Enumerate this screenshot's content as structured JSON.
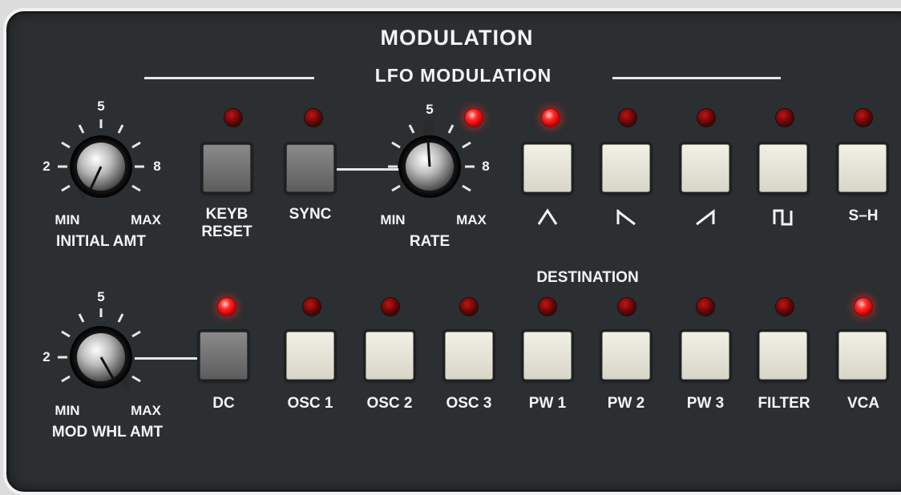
{
  "panel": {
    "title": "MODULATION",
    "subtitle": "LFO MODULATION",
    "destination_label": "DESTINATION"
  },
  "knobs": {
    "initial_amt": {
      "label": "INITIAL AMT",
      "scale_min_label": "MIN",
      "scale_max_label": "MAX",
      "tick_2": "2",
      "tick_5": "5",
      "tick_8": "8"
    },
    "rate": {
      "label": "RATE",
      "scale_min_label": "MIN",
      "scale_max_label": "MAX",
      "tick_5": "5",
      "tick_8": "8"
    },
    "mod_whl_amt": {
      "label": "MOD WHL AMT",
      "scale_min_label": "MIN",
      "scale_max_label": "MAX",
      "tick_2": "2",
      "tick_5": "5"
    }
  },
  "top_row": {
    "keyb_reset": {
      "label_line1": "KEYB",
      "label_line2": "RESET",
      "led_on": false
    },
    "sync": {
      "label": "SYNC",
      "led_on": false
    },
    "rate_led_on": true,
    "waveforms": [
      {
        "name": "triangle",
        "icon": "triangle-wave-icon",
        "led_on": true
      },
      {
        "name": "ramp-down",
        "icon": "ramp-down-wave-icon",
        "led_on": false
      },
      {
        "name": "sawtooth",
        "icon": "sawtooth-wave-icon",
        "led_on": false
      },
      {
        "name": "square",
        "icon": "square-wave-icon",
        "led_on": false
      },
      {
        "name": "sample-hold",
        "label": "S–H",
        "led_on": false
      }
    ]
  },
  "bottom_row": {
    "dc": {
      "label": "DC",
      "led_on": true
    },
    "destinations": [
      {
        "label": "OSC 1",
        "led_on": false
      },
      {
        "label": "OSC 2",
        "led_on": false
      },
      {
        "label": "OSC 3",
        "led_on": false
      },
      {
        "label": "PW 1",
        "led_on": false
      },
      {
        "label": "PW 2",
        "led_on": false
      },
      {
        "label": "PW 3",
        "led_on": false
      },
      {
        "label": "FILTER",
        "led_on": false
      },
      {
        "label": "VCA",
        "led_on": true
      }
    ]
  },
  "colors": {
    "panel": "#2b2f31",
    "led_on": "#ff3030",
    "led_off": "#5e0505",
    "text": "#f4f4f4"
  }
}
